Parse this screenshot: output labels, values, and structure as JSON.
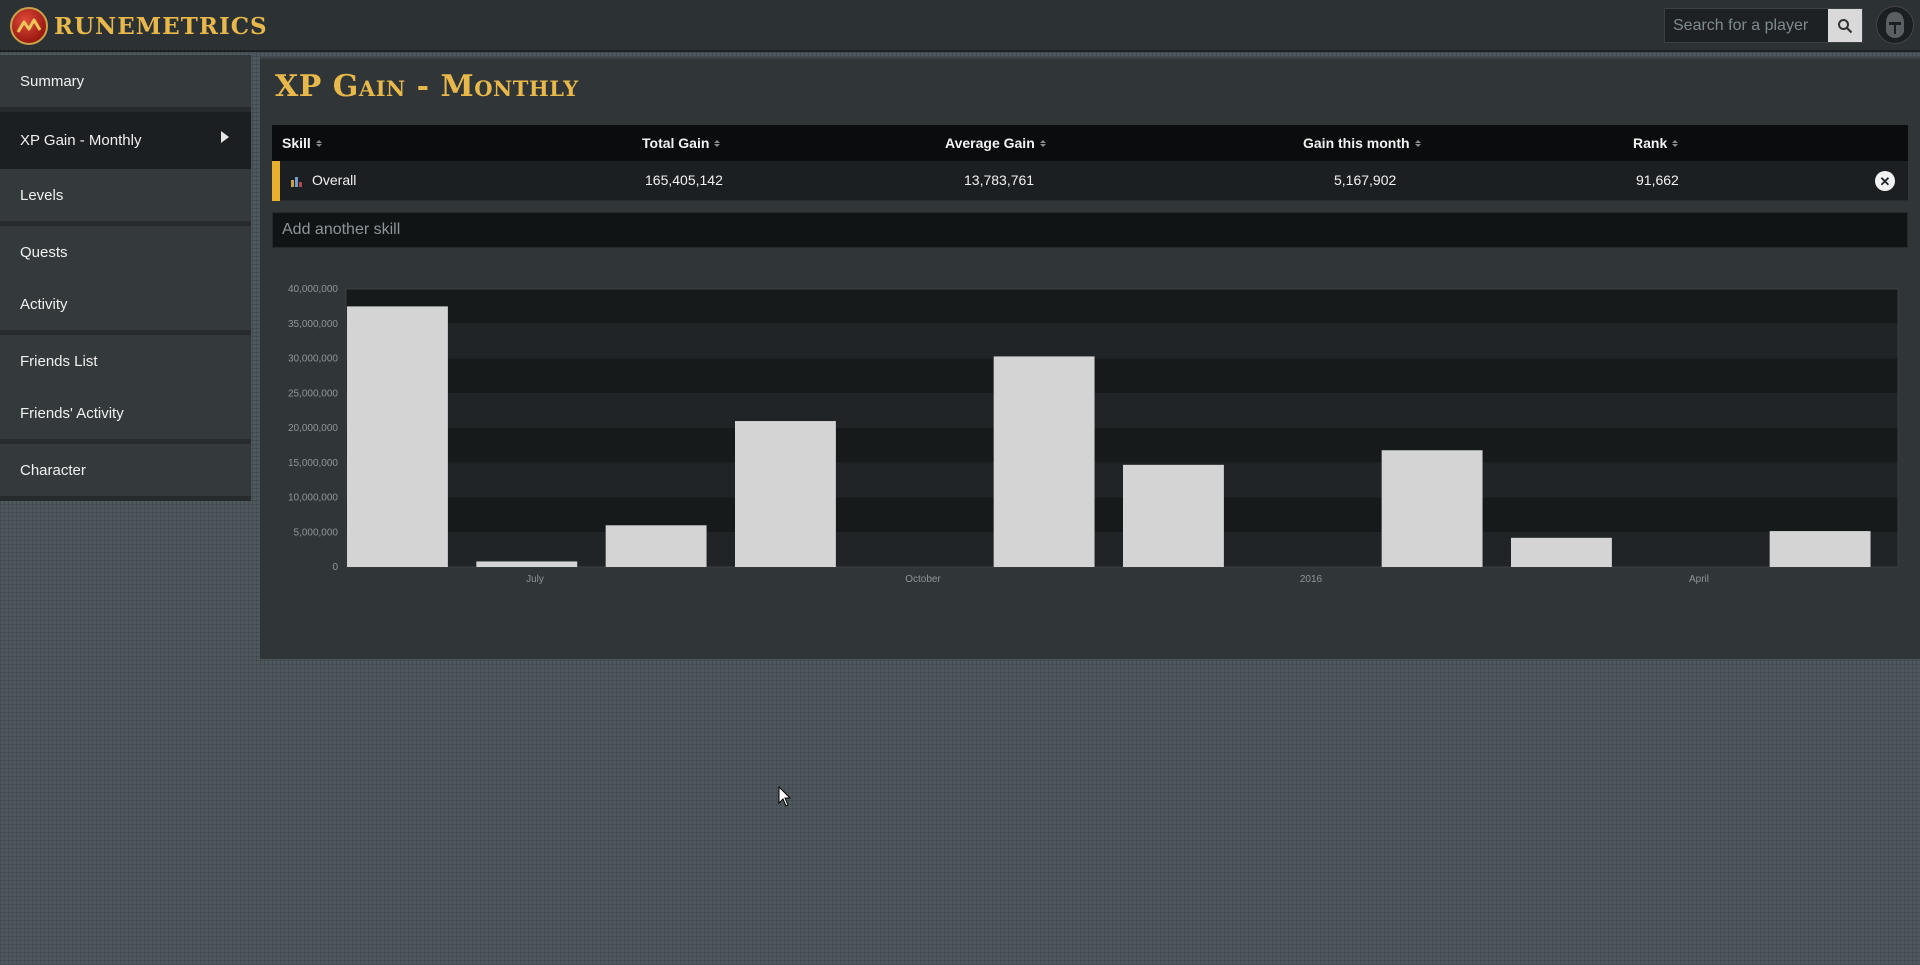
{
  "app": {
    "logo_text": "RUNEMETRICS",
    "logo_icon": "runemetrics-logo-icon"
  },
  "search": {
    "placeholder": "Search for a player",
    "button_icon": "search-icon"
  },
  "avatar": {
    "icon": "player-avatar-icon"
  },
  "sidebar": {
    "groups": [
      {
        "items": [
          {
            "label": "Summary"
          }
        ]
      },
      {
        "items": [
          {
            "label": "XP Gain - Monthly",
            "active": true
          },
          {
            "label": "Levels"
          }
        ]
      },
      {
        "items": [
          {
            "label": "Quests"
          },
          {
            "label": "Activity"
          }
        ]
      },
      {
        "items": [
          {
            "label": "Friends List"
          },
          {
            "label": "Friends' Activity"
          }
        ]
      },
      {
        "items": [
          {
            "label": "Character"
          }
        ]
      }
    ]
  },
  "main": {
    "title": "XP Gain - Monthly",
    "table": {
      "headers": [
        "Skill",
        "Total Gain",
        "Average Gain",
        "Gain this month",
        "Rank"
      ],
      "rows": [
        {
          "skill": "Overall",
          "skill_icon": "overall-skill-icon",
          "total_gain": "165,405,142",
          "average_gain": "13,783,761",
          "gain_this_month": "5,167,902",
          "rank": "91,662",
          "accent_color": "#e8b02e"
        }
      ]
    },
    "add_skill_placeholder": "Add another skill"
  },
  "chart_data": {
    "type": "bar",
    "ylim": [
      0,
      40000000
    ],
    "y_ticks": [
      "0",
      "5,000,000",
      "10,000,000",
      "15,000,000",
      "20,000,000",
      "25,000,000",
      "30,000,000",
      "35,000,000",
      "40,000,000"
    ],
    "x_tick_labels": [
      {
        "label": "July",
        "index": 1
      },
      {
        "label": "October",
        "index": 4
      },
      {
        "label": "2016",
        "index": 7
      },
      {
        "label": "April",
        "index": 10
      }
    ],
    "values": [
      37500000,
      800000,
      6000000,
      21000000,
      0,
      30300000,
      14700000,
      0,
      16800000,
      4200000,
      0,
      5167902
    ],
    "bar_color": "#d4d4d4",
    "band_colors": [
      "#161a1b",
      "#202426"
    ]
  }
}
